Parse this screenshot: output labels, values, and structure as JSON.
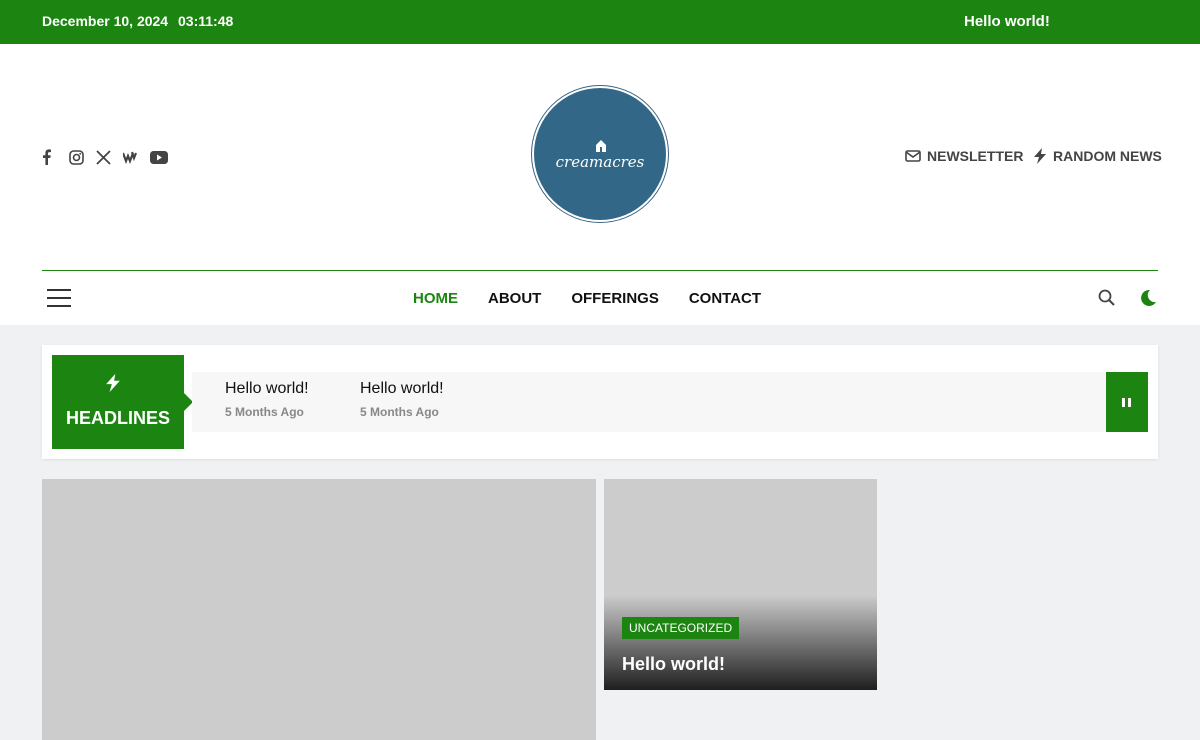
{
  "topbar": {
    "date": "December 10, 2024",
    "time": "03:11:48",
    "ticker": "Hello world!"
  },
  "header": {
    "social_icons": [
      "facebook-icon",
      "instagram-icon",
      "x-icon",
      "wistia-icon",
      "youtube-icon"
    ],
    "logo_text": "creamacres",
    "newsletter_label": "NEWSLETTER",
    "random_news_label": "RANDOM NEWS"
  },
  "nav": {
    "items": [
      {
        "label": "HOME",
        "active": true
      },
      {
        "label": "ABOUT",
        "active": false
      },
      {
        "label": "OFFERINGS",
        "active": false
      },
      {
        "label": "CONTACT",
        "active": false
      }
    ]
  },
  "headlines": {
    "label": "HEADLINES",
    "items": [
      {
        "title": "Hello world!",
        "meta": "5 Months Ago"
      },
      {
        "title": "Hello world!",
        "meta": "5 Months Ago"
      }
    ]
  },
  "cards": {
    "small": {
      "category": "UNCATEGORIZED",
      "title": "Hello world!"
    }
  },
  "colors": {
    "brand_green": "#1c8511",
    "logo_blue": "#336788"
  }
}
